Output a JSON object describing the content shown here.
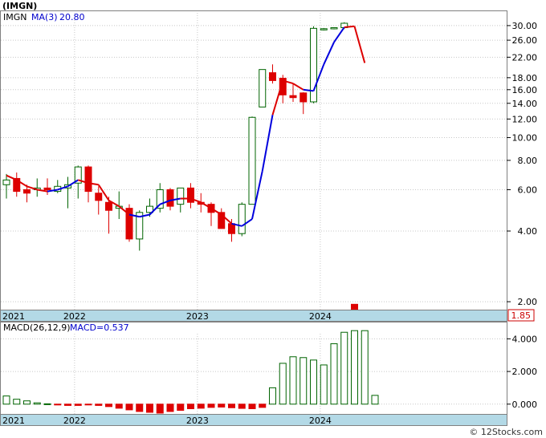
{
  "title": "(IMGN)",
  "footer": "© 12Stocks.com",
  "colors": {
    "up": "#006400",
    "down": "#dd0000",
    "ma_up": "#0000dd",
    "ma_down": "#dd0000",
    "axis_band": "#b3d9e6",
    "grid": "#c8c8c8"
  },
  "chart_data": [
    {
      "type": "candlestick",
      "scale": "log",
      "grid": true,
      "ylim": [
        1.85,
        34
      ],
      "legend_ticker": "IMGN",
      "legend_ma": "MA(3)",
      "legend_ma_value": "20.80",
      "last_price_label": "1.85",
      "y_ticks": [
        "2.00",
        "4.00",
        "6.00",
        "8.00",
        "10.00",
        "12.00",
        "14.00",
        "16.00",
        "18.00",
        "22.00",
        "26.00",
        "30.00"
      ],
      "x_labels": [
        "2021",
        "2022",
        "2023",
        "2024"
      ],
      "candles": [
        {
          "o": 6.3,
          "h": 7.0,
          "l": 5.5,
          "c": 6.6
        },
        {
          "o": 6.7,
          "h": 7.1,
          "l": 5.6,
          "c": 5.9
        },
        {
          "o": 6.0,
          "h": 6.3,
          "l": 5.3,
          "c": 5.8
        },
        {
          "o": 6.0,
          "h": 6.7,
          "l": 5.6,
          "c": 6.1
        },
        {
          "o": 6.1,
          "h": 6.7,
          "l": 5.7,
          "c": 6.0
        },
        {
          "o": 5.9,
          "h": 6.6,
          "l": 5.8,
          "c": 6.2
        },
        {
          "o": 6.1,
          "h": 6.8,
          "l": 5.0,
          "c": 6.3
        },
        {
          "o": 6.4,
          "h": 7.6,
          "l": 5.5,
          "c": 7.5
        },
        {
          "o": 7.5,
          "h": 7.6,
          "l": 5.3,
          "c": 5.9
        },
        {
          "o": 5.8,
          "h": 6.2,
          "l": 4.7,
          "c": 5.4
        },
        {
          "o": 5.3,
          "h": 5.6,
          "l": 3.9,
          "c": 4.9
        },
        {
          "o": 5.0,
          "h": 5.9,
          "l": 4.5,
          "c": 5.1
        },
        {
          "o": 5.0,
          "h": 5.2,
          "l": 3.6,
          "c": 3.7
        },
        {
          "o": 3.7,
          "h": 4.9,
          "l": 3.3,
          "c": 4.8
        },
        {
          "o": 4.8,
          "h": 5.5,
          "l": 4.6,
          "c": 5.1
        },
        {
          "o": 5.0,
          "h": 6.4,
          "l": 4.8,
          "c": 6.0
        },
        {
          "o": 6.0,
          "h": 6.1,
          "l": 4.9,
          "c": 5.1
        },
        {
          "o": 5.2,
          "h": 5.6,
          "l": 4.8,
          "c": 6.1
        },
        {
          "o": 6.1,
          "h": 6.4,
          "l": 5.0,
          "c": 5.3
        },
        {
          "o": 5.3,
          "h": 5.8,
          "l": 4.8,
          "c": 5.2
        },
        {
          "o": 5.2,
          "h": 5.3,
          "l": 4.2,
          "c": 4.8
        },
        {
          "o": 4.8,
          "h": 5.0,
          "l": 4.1,
          "c": 4.1
        },
        {
          "o": 4.3,
          "h": 4.5,
          "l": 3.6,
          "c": 3.9
        },
        {
          "o": 3.9,
          "h": 5.3,
          "l": 3.8,
          "c": 5.2
        },
        {
          "o": 5.2,
          "h": 12.3,
          "l": 5.2,
          "c": 12.2
        },
        {
          "o": 13.5,
          "h": 19.5,
          "l": 13.5,
          "c": 19.5
        },
        {
          "o": 18.9,
          "h": 20.5,
          "l": 17.0,
          "c": 17.5
        },
        {
          "o": 17.9,
          "h": 18.5,
          "l": 14.0,
          "c": 15.2
        },
        {
          "o": 15.1,
          "h": 16.9,
          "l": 14.2,
          "c": 14.8
        },
        {
          "o": 15.5,
          "h": 15.6,
          "l": 12.6,
          "c": 14.2
        },
        {
          "o": 14.2,
          "h": 29.8,
          "l": 14.0,
          "c": 29.2
        },
        {
          "o": 29.0,
          "h": 29.3,
          "l": 28.6,
          "c": 29.1
        },
        {
          "o": 29.2,
          "h": 29.5,
          "l": 28.9,
          "c": 29.4
        },
        {
          "o": 29.4,
          "h": 31.0,
          "l": 29.0,
          "c": 30.7
        },
        {
          "o": 1.95,
          "h": 1.95,
          "l": 1.75,
          "c": 1.75
        }
      ],
      "ma3": [
        6.9,
        6.6,
        6.2,
        6.0,
        5.9,
        6.0,
        6.2,
        6.6,
        6.4,
        6.3,
        5.4,
        5.1,
        4.7,
        4.6,
        4.7,
        5.2,
        5.4,
        5.5,
        5.5,
        5.3,
        5.0,
        4.7,
        4.3,
        4.2,
        4.5,
        7.2,
        12.5,
        17.5,
        17.0,
        16.0,
        15.8,
        20.5,
        25.5,
        29.5,
        29.8,
        20.8
      ],
      "ma_direction": [
        "down",
        "down",
        "down",
        "down",
        "down",
        "up",
        "up",
        "up",
        "down",
        "down",
        "down",
        "down",
        "down",
        "up",
        "up",
        "up",
        "up",
        "up",
        "down",
        "down",
        "down",
        "down",
        "down",
        "up",
        "up",
        "up",
        "up",
        "down",
        "down",
        "down",
        "up",
        "up",
        "up",
        "up",
        "down",
        "down"
      ]
    },
    {
      "type": "bar",
      "title": "MACD(26,12,9)",
      "value_label": "MACD=0.537",
      "ylim": [
        -0.6,
        5.0
      ],
      "y_ticks": [
        "0.000",
        "2.000",
        "4.000"
      ],
      "x_labels": [
        "2021",
        "2022",
        "2023",
        "2024"
      ],
      "values": [
        0.5,
        0.3,
        0.2,
        0.08,
        0.02,
        -0.05,
        -0.08,
        -0.08,
        -0.02,
        -0.08,
        -0.15,
        -0.25,
        -0.35,
        -0.45,
        -0.5,
        -0.55,
        -0.45,
        -0.38,
        -0.28,
        -0.25,
        -0.2,
        -0.18,
        -0.22,
        -0.26,
        -0.28,
        -0.2,
        1.0,
        2.5,
        2.9,
        2.85,
        2.7,
        2.4,
        3.7,
        4.4,
        4.5,
        4.5,
        0.537
      ]
    }
  ]
}
